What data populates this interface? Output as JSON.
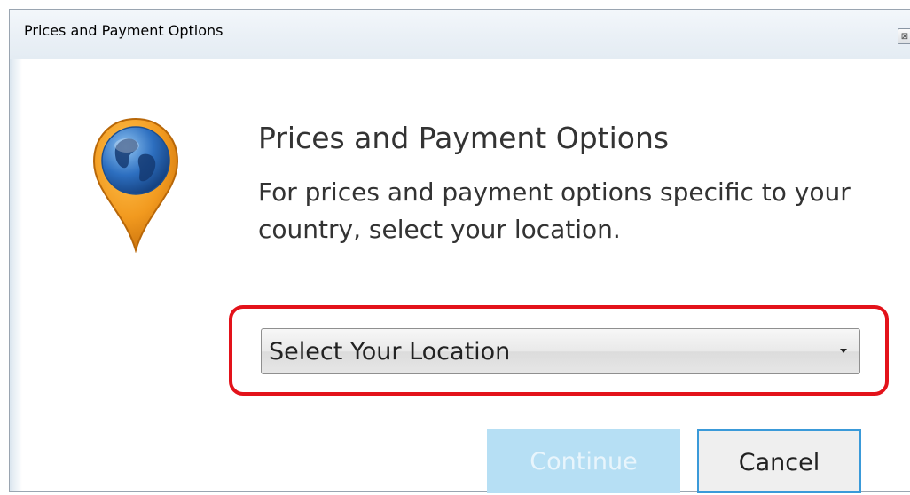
{
  "window": {
    "title": "Prices and Payment Options",
    "close_glyph": "⊠"
  },
  "dialog": {
    "icon": "globe-location-pin-icon",
    "heading": "Prices and Payment Options",
    "description": "For prices and payment options specific to your country, select your location.",
    "location_select": {
      "value": "Select Your Location"
    },
    "buttons": {
      "continue_label": "Continue",
      "cancel_label": "Cancel"
    }
  },
  "colors": {
    "highlight_ring": "#e3121a",
    "continue_bg_disabled": "#b6dff4",
    "cancel_border": "#3a9ad9",
    "pin_orange": "#f29a1f",
    "globe_blue": "#2d6fc0"
  }
}
